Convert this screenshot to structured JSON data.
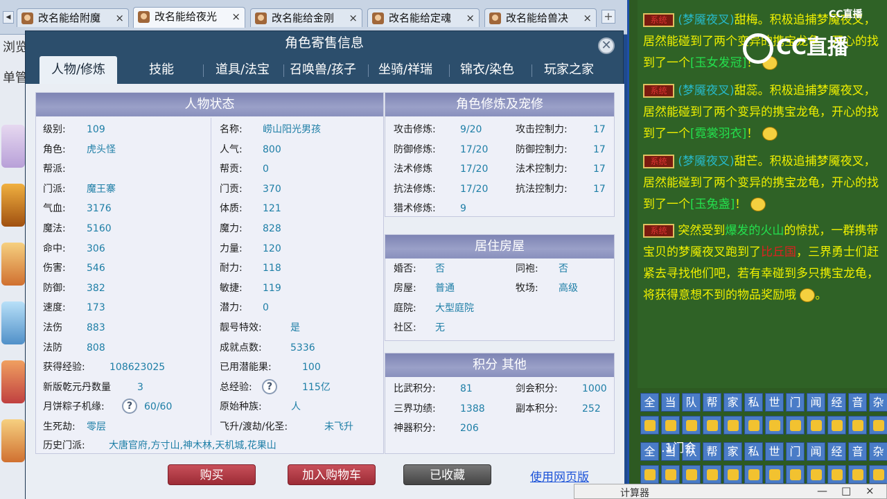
{
  "browser": {
    "tabs": [
      {
        "label": "改名能给附魔",
        "close": "×"
      },
      {
        "label": "改名能给夜光",
        "close": "×"
      },
      {
        "label": "改名能给金刚",
        "close": "×"
      },
      {
        "label": "改名能给定魂",
        "close": "×"
      },
      {
        "label": "改名能给兽决",
        "close": "×"
      }
    ],
    "active_tab": 1,
    "new_tab": "+",
    "behind_text_1": "浏览",
    "behind_text_2": "单管"
  },
  "dialog": {
    "title": "角色寄售信息",
    "close": "✕",
    "tabs": [
      "人物/修炼",
      "技能",
      "道具/法宝",
      "召唤兽/孩子",
      "坐骑/祥瑞",
      "锦衣/染色",
      "玩家之家"
    ],
    "active_tab": 0
  },
  "status": {
    "header": "人物状态",
    "rows": [
      {
        "l1": "级别:",
        "v1": "109",
        "l2": "名称:",
        "v2": "崂山阳光男孩"
      },
      {
        "l1": "角色:",
        "v1": "虎头怪",
        "l2": "人气:",
        "v2": "800"
      },
      {
        "l1": "帮派:",
        "v1": "",
        "l2": "帮贡:",
        "v2": "0"
      },
      {
        "l1": "门派:",
        "v1": "魔王寨",
        "l2": "门贡:",
        "v2": "370"
      },
      {
        "l1": "气血:",
        "v1": "3176",
        "l2": "体质:",
        "v2": "121"
      },
      {
        "l1": "魔法:",
        "v1": "5160",
        "l2": "魔力:",
        "v2": "828"
      },
      {
        "l1": "命中:",
        "v1": "306",
        "l2": "力量:",
        "v2": "120"
      },
      {
        "l1": "伤害:",
        "v1": "546",
        "l2": "耐力:",
        "v2": "118"
      },
      {
        "l1": "防御:",
        "v1": "382",
        "l2": "敏捷:",
        "v2": "119"
      },
      {
        "l1": "速度:",
        "v1": "173",
        "l2": "潜力:",
        "v2": "0"
      },
      {
        "l1": "法伤",
        "v1": "883",
        "l2": "靓号特效:",
        "v2": "是"
      },
      {
        "l1": "法防",
        "v1": "808",
        "l2": "成就点数:",
        "v2": "5336"
      },
      {
        "l1": "获得经验:",
        "v1": "108623025",
        "l2": "已用潜能果:",
        "v2": "100"
      },
      {
        "l1": "新版乾元丹数量",
        "v1": "3",
        "l2": "总经验:",
        "v2": "115亿"
      },
      {
        "l1": "月饼粽子机缘:",
        "v1": "60/60",
        "l2": "原始种族:",
        "v2": "人"
      },
      {
        "l1": "生死劫:",
        "v1": "零层",
        "l2": "飞升/渡劫/化圣:",
        "v2": "未飞升"
      }
    ],
    "history_label": "历史门派:",
    "history_value": "大唐官府,方寸山,神木林,天机城,花果山",
    "help": "?"
  },
  "cultivation": {
    "header": "角色修炼及宠修",
    "rows": [
      {
        "l1": "攻击修炼:",
        "v1": "9/20",
        "l2": "攻击控制力:",
        "v2": "17"
      },
      {
        "l1": "防御修炼:",
        "v1": "17/20",
        "l2": "防御控制力:",
        "v2": "17"
      },
      {
        "l1": "法术修炼",
        "v1": "17/20",
        "l2": "法术控制力:",
        "v2": "17"
      },
      {
        "l1": "抗法修炼:",
        "v1": "17/20",
        "l2": "抗法控制力:",
        "v2": "17"
      },
      {
        "l1": "猎术修炼:",
        "v1": "9",
        "l2": "",
        "v2": ""
      }
    ]
  },
  "house": {
    "header": "居住房屋",
    "rows": [
      {
        "l1": "婚否:",
        "v1": "否",
        "l2": "同袍:",
        "v2": "否"
      },
      {
        "l1": "房屋:",
        "v1": "普通",
        "l2": "牧场:",
        "v2": "高级"
      },
      {
        "l1": "庭院:",
        "v1": "大型庭院",
        "l2": "",
        "v2": ""
      },
      {
        "l1": "社区:",
        "v1": "无",
        "l2": "",
        "v2": ""
      }
    ]
  },
  "points": {
    "header": "积分 其他",
    "rows": [
      {
        "l1": "比武积分:",
        "v1": "81",
        "l2": "剑会积分:",
        "v2": "1000"
      },
      {
        "l1": "三界功绩:",
        "v1": "1388",
        "l2": "副本积分:",
        "v2": "252"
      },
      {
        "l1": "神器积分:",
        "v1": "206",
        "l2": "",
        "v2": ""
      }
    ]
  },
  "actions": {
    "buy": "购买",
    "cart": "加入购物车",
    "fav": "已收藏",
    "web": "使用网页版"
  },
  "chat": {
    "sys_tag": "系统",
    "logo": "CC直播",
    "logo_small": "CC直播",
    "m1": {
      "who": "(梦魇夜叉)",
      "name": "甜梅",
      "text1": "。积极追捕梦魇夜叉，居然能碰到了两个变异的携宝龙龟，开心的找到了一个",
      "item": "[玉女发冠]",
      "end": "！"
    },
    "m2": {
      "who": "(梦魇夜叉)",
      "name": "甜蕊",
      "text1": "。积极追捕梦魇夜叉，居然能碰到了两个变异的携宝龙龟，开心的找到了一个",
      "item": "[霓裳羽衣]",
      "end": "！"
    },
    "m3": {
      "who": "(梦魇夜叉)",
      "name": "甜芒",
      "text1": "。积极追捕梦魇夜叉，居然能碰到了两个变异的携宝龙龟，开心的找到了一个",
      "item": "[玉兔盏]",
      "end": "！"
    },
    "m4": {
      "pre": "突然受到",
      "hl": "爆发的火山",
      "mid": "的惊扰，一群携带宝贝的梦魇夜叉跑到了",
      "place": "比丘国",
      "post": "，三界勇士们赶紧去寻找他们吧，若有幸碰到多只携宝龙龟，将获得意想不到的物品奖励哦",
      "end": "。"
    },
    "channels": [
      "全",
      "当",
      "队",
      "帮",
      "家",
      "私",
      "世",
      "门",
      "闻",
      "经",
      "音",
      "杂"
    ],
    "input_text": "․1门会"
  },
  "calc": {
    "title": "计算器",
    "min": "—",
    "max": "□",
    "close": "×"
  },
  "colors": {
    "dialog_bg": "#2c4e6c",
    "panel_head": "#8990bd",
    "value_text": "#1d7ea6",
    "buy_button": "#9c2b35",
    "chat_bg": "#2f6226"
  }
}
